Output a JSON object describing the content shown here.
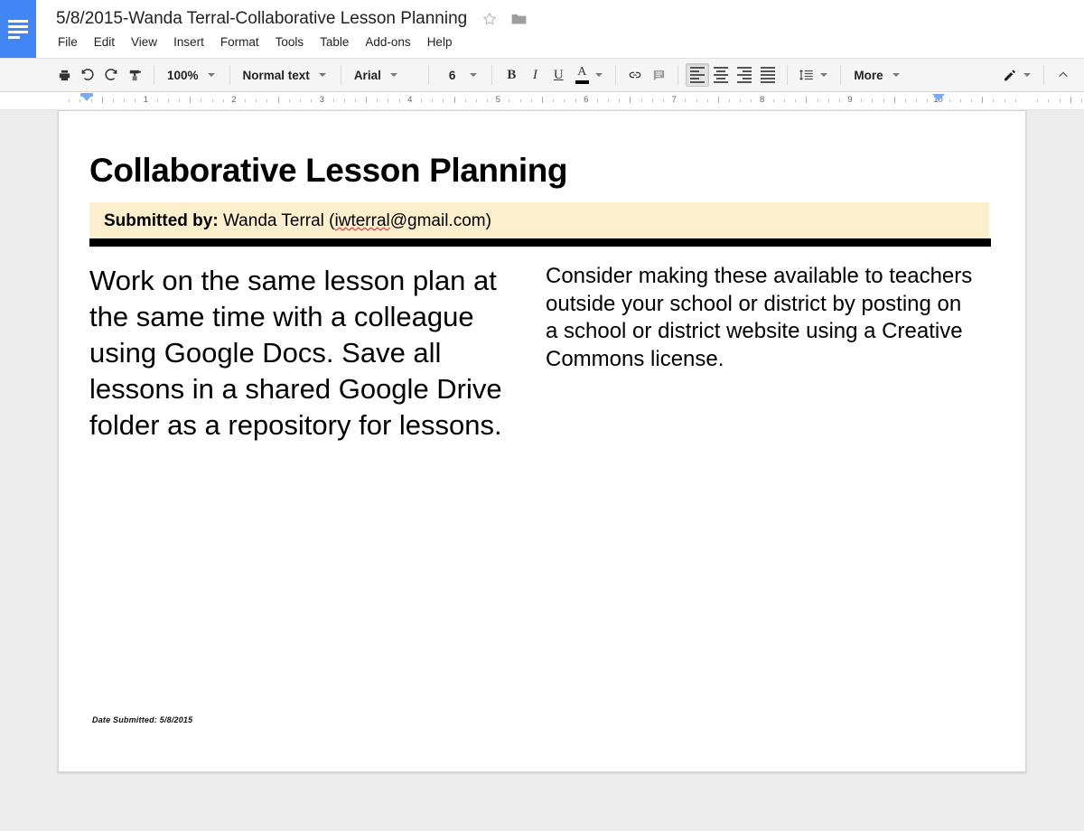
{
  "app": {
    "logo_icon": "google-docs-logo-icon",
    "brand_color": "#4285f4"
  },
  "header": {
    "doc_title": "5/8/2015-Wanda Terral-Collaborative Lesson Planning",
    "star_icon": "star-outline-icon",
    "folder_icon": "folder-icon",
    "menus": [
      {
        "label": "File"
      },
      {
        "label": "Edit"
      },
      {
        "label": "View"
      },
      {
        "label": "Insert"
      },
      {
        "label": "Format"
      },
      {
        "label": "Tools"
      },
      {
        "label": "Table"
      },
      {
        "label": "Add-ons"
      },
      {
        "label": "Help"
      }
    ]
  },
  "toolbar": {
    "print_icon": "print-icon",
    "undo_icon": "undo-icon",
    "redo_icon": "redo-icon",
    "paint_format_icon": "paint-format-icon",
    "zoom_value": "100%",
    "paragraph_style_value": "Normal text",
    "font_value": "Arial",
    "font_size_value": "6",
    "bold_label": "B",
    "italic_label": "I",
    "underline_label": "U",
    "text_color_label": "A",
    "text_color_swatch": "#000000",
    "link_icon": "link-icon",
    "comment_icon": "add-comment-icon",
    "align_left_icon": "align-left-icon",
    "align_center_icon": "align-center-icon",
    "align_right_icon": "align-right-icon",
    "align_justify_icon": "align-justify-icon",
    "line_spacing_icon": "line-spacing-icon",
    "more_label": "More",
    "edit_mode_icon": "pencil-icon",
    "collapse_icon": "chevron-up-icon",
    "active_alignment": "align-left-icon"
  },
  "ruler": {
    "numbers": [
      "1",
      "2",
      "3",
      "4",
      "5",
      "6",
      "7",
      "8",
      "9",
      "10"
    ],
    "left_indent_marker": "left-indent-marker",
    "right_indent_marker": "right-indent-marker"
  },
  "document": {
    "heading": "Collaborative Lesson Planning",
    "banner": {
      "label": "Submitted by:",
      "name": "Wanda Terral (",
      "email": "iwterral",
      "email_rest": "@gmail.com)",
      "background_color": "#fcefcd"
    },
    "columns": {
      "left": "Work on the same lesson plan at the same time with a colleague using Google Docs. Save all lessons in a shared Google Drive folder as a repository for lessons.",
      "right": "Consider making these available to teachers outside your school or district by posting on a school or district website using a Creative Commons license."
    },
    "footer_note": "Date Submitted: 5/8/2015"
  }
}
